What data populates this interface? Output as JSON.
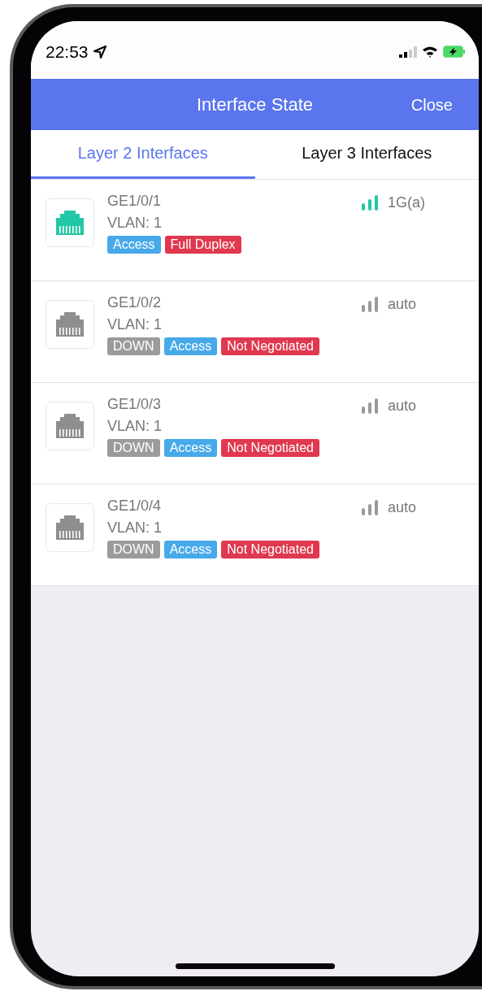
{
  "status_bar": {
    "time": "22:53"
  },
  "header": {
    "title": "Interface State",
    "close": "Close"
  },
  "tabs": [
    {
      "label": "Layer 2 Interfaces",
      "selected": true
    },
    {
      "label": "Layer 3 Interfaces",
      "selected": false
    }
  ],
  "interfaces": [
    {
      "name": "GE1/0/1",
      "vlan": "VLAN: 1",
      "link_up": true,
      "speed": "1G(a)",
      "tags": [
        {
          "kind": "mode",
          "text": "Access"
        },
        {
          "kind": "duplex",
          "text": "Full Duplex"
        }
      ]
    },
    {
      "name": "GE1/0/2",
      "vlan": "VLAN: 1",
      "link_up": false,
      "speed": "auto",
      "tags": [
        {
          "kind": "status",
          "text": "DOWN"
        },
        {
          "kind": "mode",
          "text": "Access"
        },
        {
          "kind": "duplex",
          "text": "Not Negotiated"
        }
      ]
    },
    {
      "name": "GE1/0/3",
      "vlan": "VLAN: 1",
      "link_up": false,
      "speed": "auto",
      "tags": [
        {
          "kind": "status",
          "text": "DOWN"
        },
        {
          "kind": "mode",
          "text": "Access"
        },
        {
          "kind": "duplex",
          "text": "Not Negotiated"
        }
      ]
    },
    {
      "name": "GE1/0/4",
      "vlan": "VLAN: 1",
      "link_up": false,
      "speed": "auto",
      "tags": [
        {
          "kind": "status",
          "text": "DOWN"
        },
        {
          "kind": "mode",
          "text": "Access"
        },
        {
          "kind": "duplex",
          "text": "Not Negotiated"
        }
      ]
    }
  ]
}
